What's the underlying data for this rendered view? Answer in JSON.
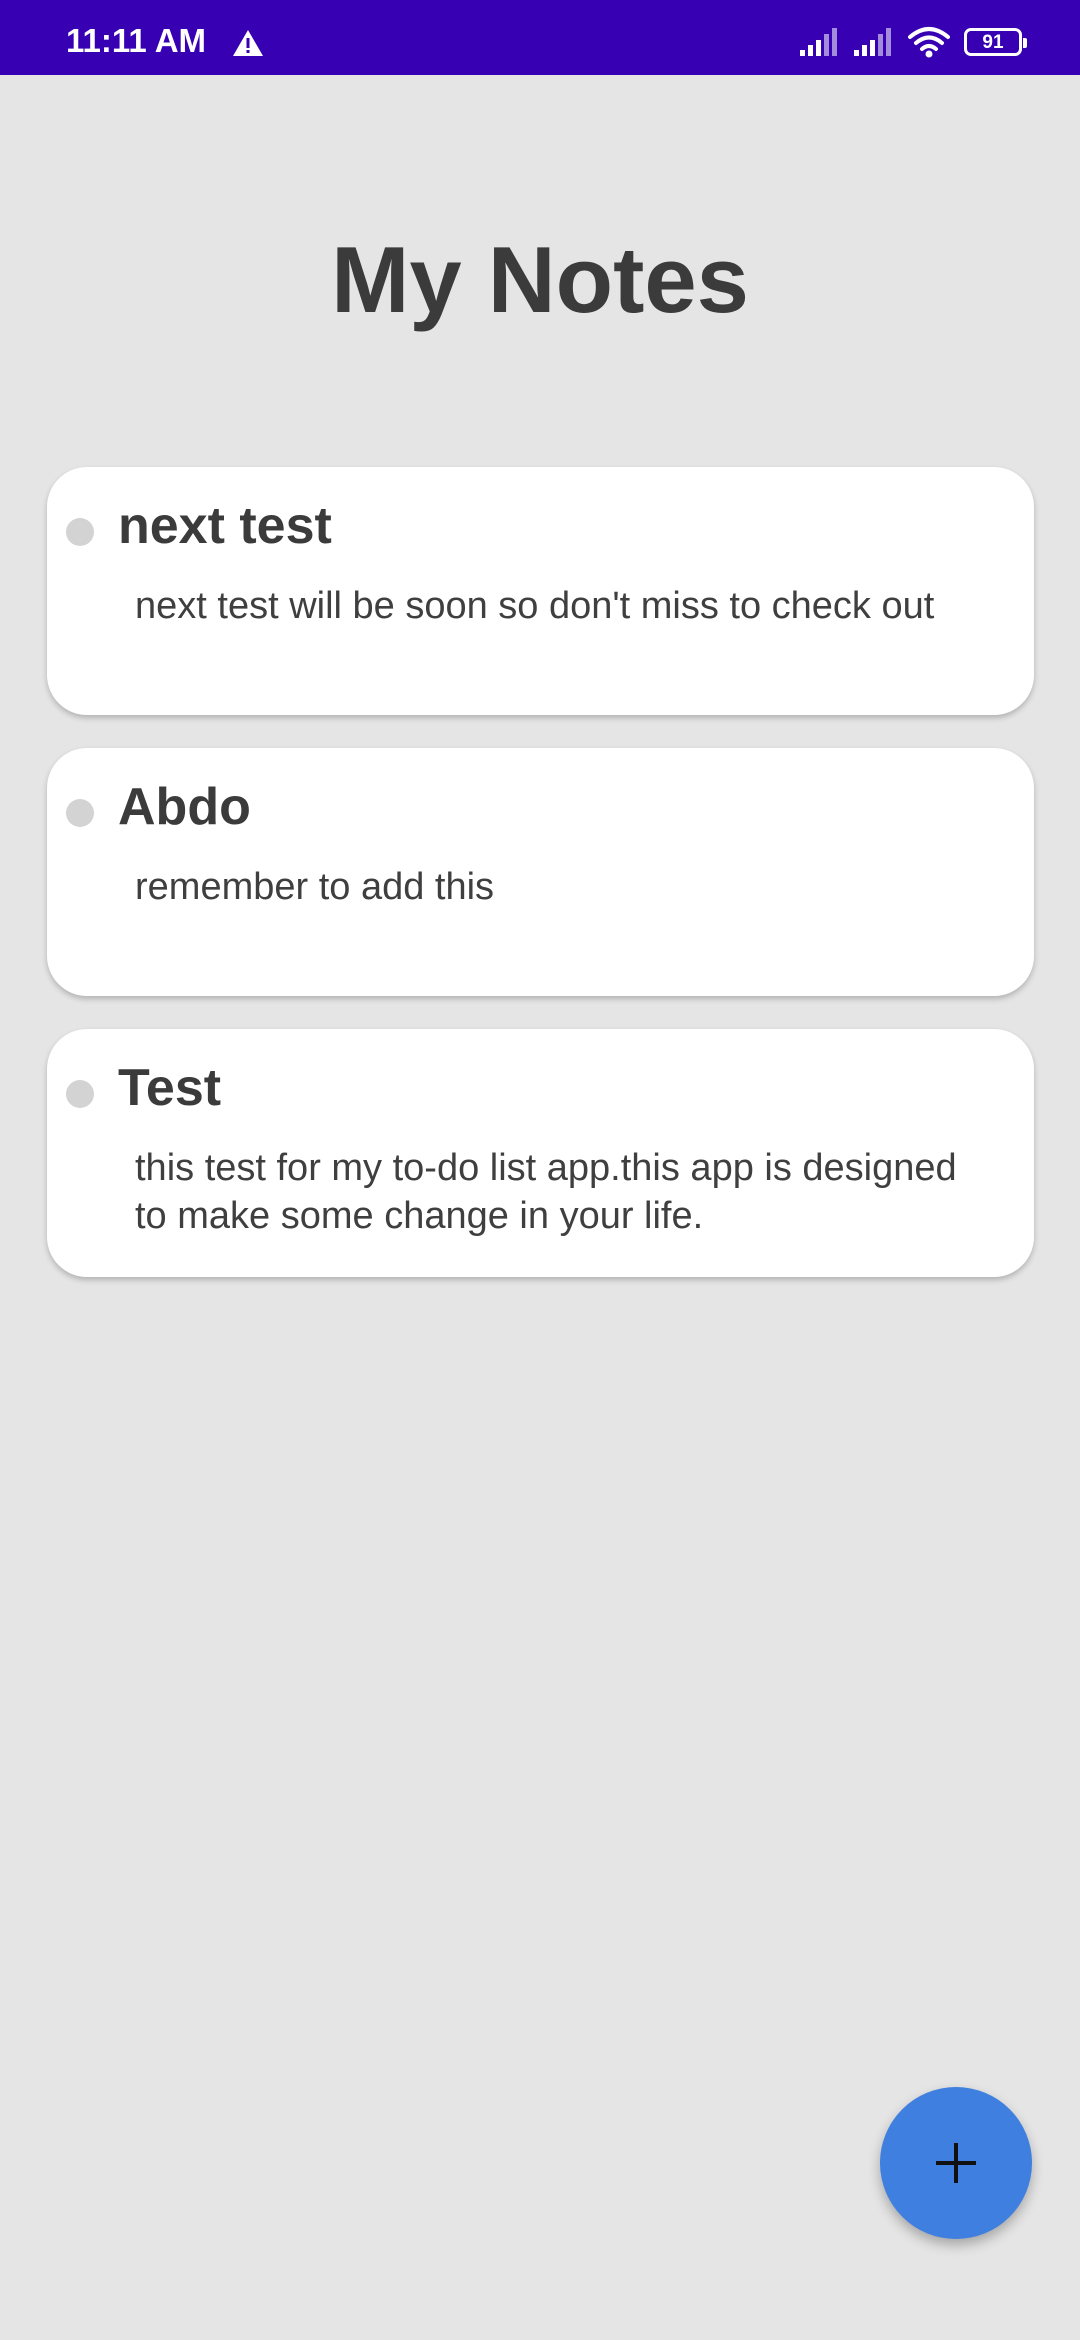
{
  "status_bar": {
    "time": "11:11 AM",
    "battery_level": "91",
    "icons": [
      "warning-icon",
      "signal-icon",
      "signal-icon",
      "wifi-icon",
      "battery-icon"
    ],
    "background_color": "#3700b3"
  },
  "header": {
    "title": "My Notes"
  },
  "notes": [
    {
      "title": "next test",
      "body": "next test will be soon so don't miss to check out"
    },
    {
      "title": "Abdo",
      "body": "remember to add this"
    },
    {
      "title": "Test",
      "body": "this test for my to-do list app.this app is designed to make some change in your life."
    }
  ],
  "fab": {
    "icon": "plus-icon",
    "color": "#3f7fe0"
  },
  "colors": {
    "background": "#e5e5e5",
    "card": "#ffffff",
    "text": "#3b3b3b",
    "dot": "#d3d3d3"
  }
}
